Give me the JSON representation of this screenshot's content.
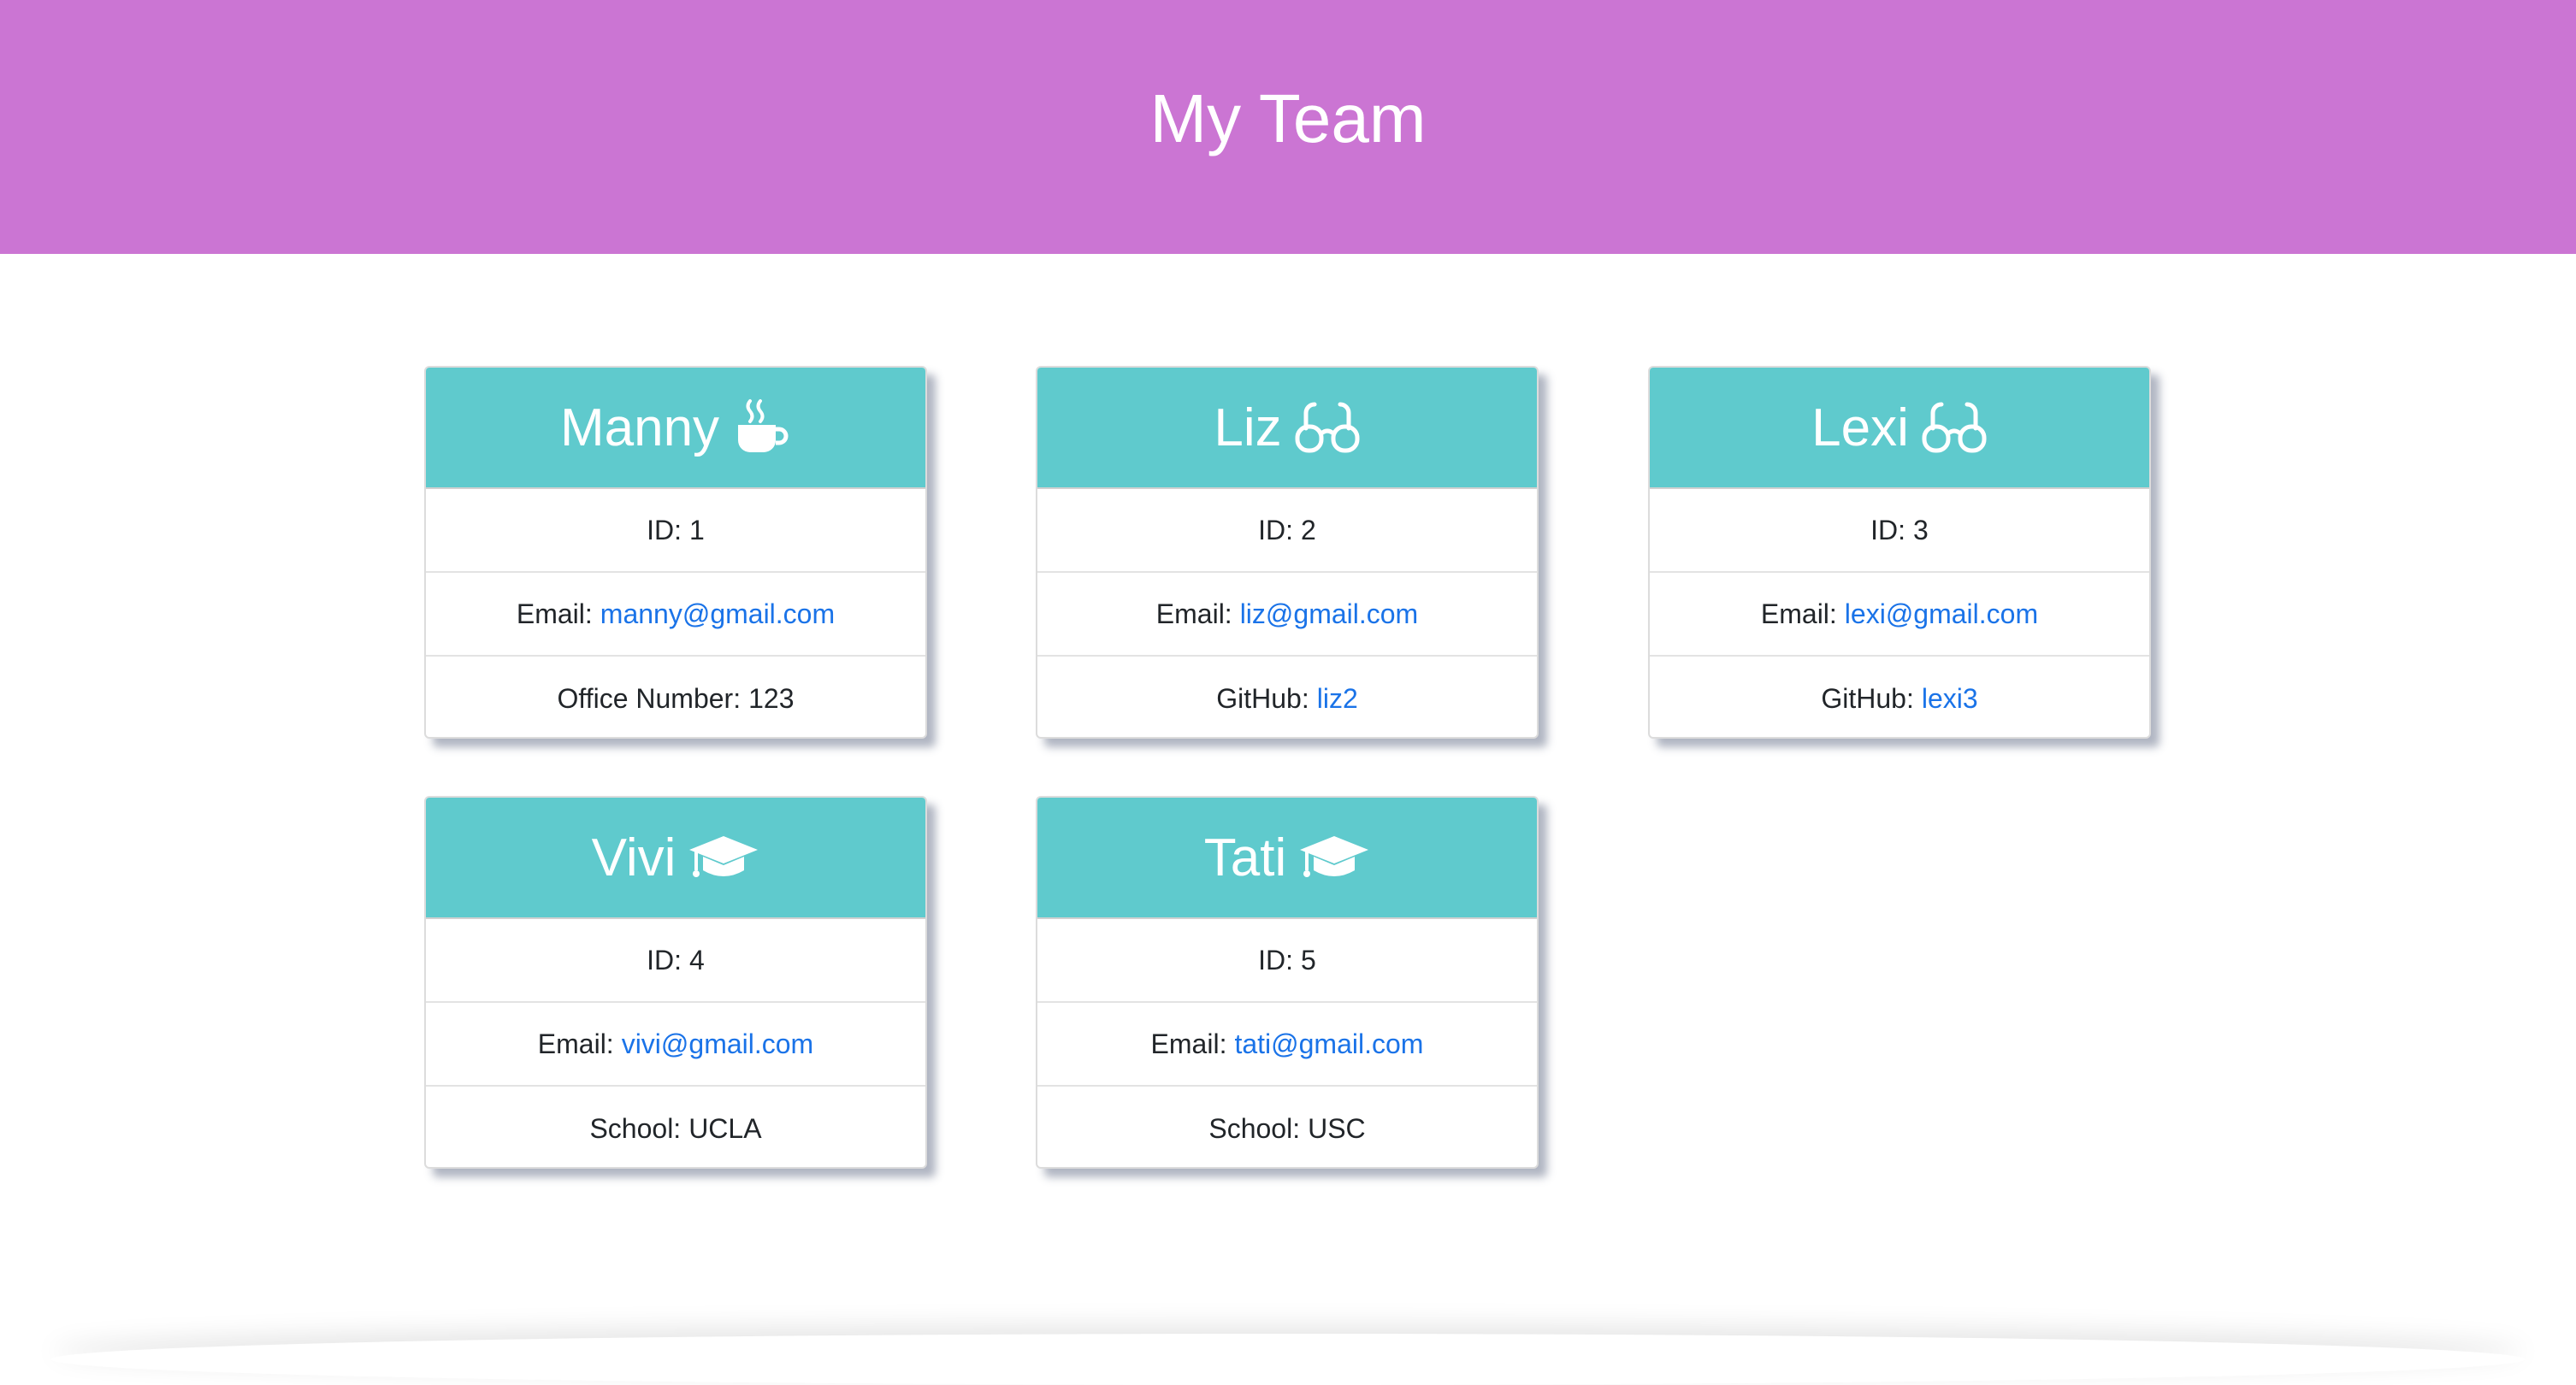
{
  "header": {
    "title": "My Team"
  },
  "colors": {
    "header_bg": "#cb75d3",
    "card_header_bg": "#5fcacd",
    "link": "#1a73e8"
  },
  "cards": [
    {
      "name": "Manny",
      "icon": "coffee-icon",
      "id_label": "ID:",
      "id_value": "1",
      "email_label": "Email:",
      "email_value": "manny@gmail.com",
      "extra_label": "Office Number:",
      "extra_value": "123"
    },
    {
      "name": "Liz",
      "icon": "glasses-icon",
      "id_label": "ID:",
      "id_value": "2",
      "email_label": "Email:",
      "email_value": "liz@gmail.com",
      "extra_label": "GitHub:",
      "extra_value": "liz2"
    },
    {
      "name": "Lexi",
      "icon": "glasses-icon",
      "id_label": "ID:",
      "id_value": "3",
      "email_label": "Email:",
      "email_value": "lexi@gmail.com",
      "extra_label": "GitHub:",
      "extra_value": "lexi3"
    },
    {
      "name": "Vivi",
      "icon": "graduation-cap-icon",
      "id_label": "ID:",
      "id_value": "4",
      "email_label": "Email:",
      "email_value": "vivi@gmail.com",
      "extra_label": "School:",
      "extra_value": "UCLA"
    },
    {
      "name": "Tati",
      "icon": "graduation-cap-icon",
      "id_label": "ID:",
      "id_value": "5",
      "email_label": "Email:",
      "email_value": "tati@gmail.com",
      "extra_label": "School:",
      "extra_value": "USC"
    }
  ]
}
